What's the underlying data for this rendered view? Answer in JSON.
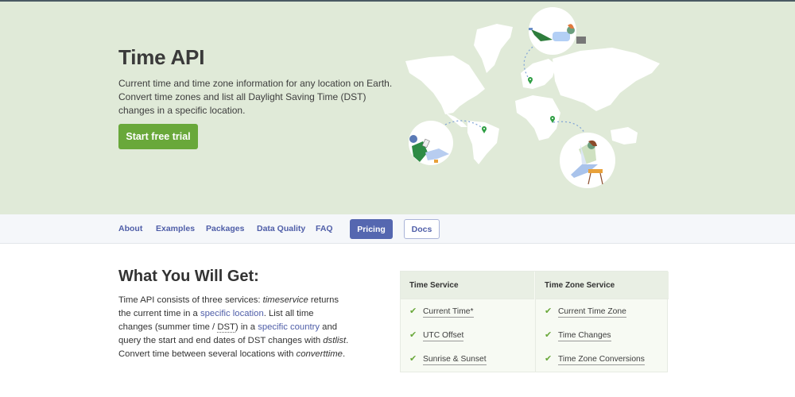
{
  "hero": {
    "title": "Time API",
    "description": "Current time and time zone information for any location on Earth. Convert time zones and list all Daylight Saving Time (DST) changes in a specific location.",
    "cta_label": "Start free trial",
    "colors": {
      "background": "#e0ead8",
      "cta": "#69a83a"
    },
    "illustration": {
      "type": "world-map",
      "pins": [
        "europe",
        "south-america",
        "east-africa"
      ],
      "people": [
        "person-lying-with-laptop",
        "person-sitting-with-tablet",
        "person-on-stool-with-laptop"
      ]
    }
  },
  "nav": {
    "links": [
      {
        "label": "About"
      },
      {
        "label": "Examples"
      },
      {
        "label": "Packages"
      },
      {
        "label": "Data Quality"
      },
      {
        "label": "FAQ"
      }
    ],
    "pricing_label": "Pricing",
    "docs_label": "Docs",
    "colors": {
      "link": "#4f5ea8",
      "pricing_bg": "#5567b0"
    }
  },
  "section": {
    "title": "What You Will Get:",
    "text": {
      "p1": "Time API consists of three services: ",
      "em1": "timeservice",
      "p2": " returns the current time in a ",
      "link1": "specific location",
      "p3": ". List all time changes (summer time / ",
      "abbr1": "DST",
      "p4": ") in a ",
      "link2": "specific country",
      "p5": " and query the start and end dates of DST changes with ",
      "em2": "dstlist",
      "p6": ". Convert time between several locations with ",
      "em3": "converttime",
      "p7": "."
    }
  },
  "services": {
    "columns": [
      {
        "header": "Time Service",
        "items": [
          "Current Time*",
          "UTC Offset",
          "Sunrise & Sunset"
        ]
      },
      {
        "header": "Time Zone Service",
        "items": [
          "Current Time Zone",
          "Time Changes",
          "Time Zone Conversions"
        ]
      }
    ],
    "check_icon": "✔"
  }
}
